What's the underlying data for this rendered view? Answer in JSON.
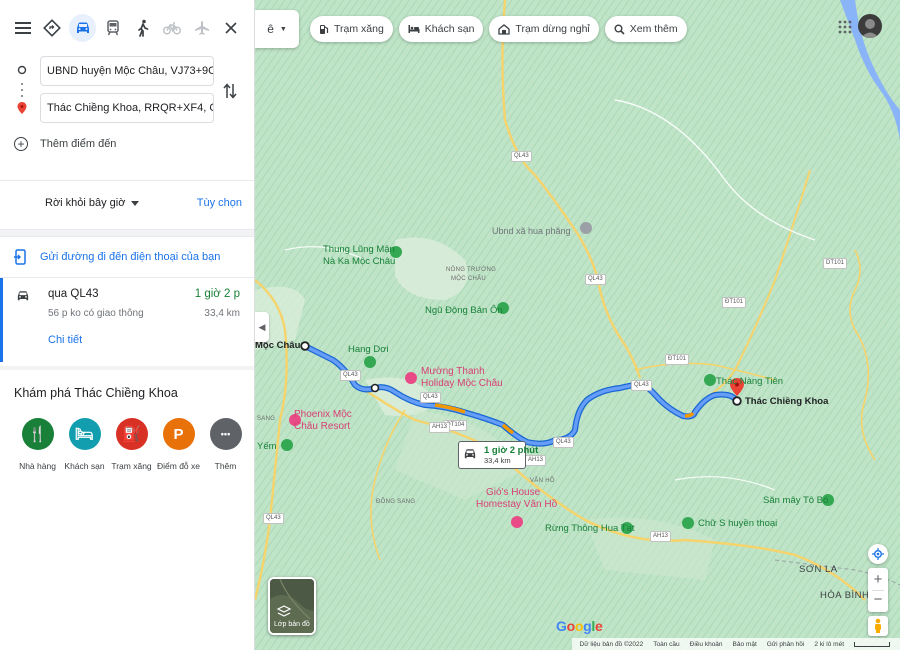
{
  "panel": {
    "travel_modes": [
      {
        "name": "best-route",
        "icon": "diamond-directions-icon",
        "state": "normal"
      },
      {
        "name": "driving",
        "icon": "car-icon",
        "state": "active"
      },
      {
        "name": "transit",
        "icon": "train-icon",
        "state": "normal"
      },
      {
        "name": "walking",
        "icon": "walk-icon",
        "state": "normal"
      },
      {
        "name": "cycling",
        "icon": "bicycle-icon",
        "state": "disabled"
      },
      {
        "name": "flights",
        "icon": "plane-icon",
        "state": "disabled"
      }
    ],
    "origin": "UBND huyện Mộc Châu, VJ73+9C3, TT. Mộc Châu",
    "destination": "Thác Chiềng Khoa, RRQR+XF4, Chiềng Khoa",
    "add_destination": "Thêm điểm đến",
    "depart_label": "Rời khỏi bây giờ",
    "options_label": "Tùy chọn",
    "send_to_phone": "Gửi đường đi đến điện thoại của bạn",
    "route": {
      "via": "qua QL43",
      "duration": "1 giờ 2 p",
      "traffic": "56 p ko có giao thông",
      "distance": "33,4 km",
      "details": "Chi tiết"
    },
    "explore": {
      "title": "Khám phá Thác Chiềng Khoa",
      "categories": [
        {
          "label": "Nhà hàng",
          "icon": "restaurant-icon",
          "color": "#188038",
          "glyph": "🍴"
        },
        {
          "label": "Khách sạn",
          "icon": "hotel-icon",
          "color": "#129eaf",
          "glyph": "🛏"
        },
        {
          "label": "Trạm xăng",
          "icon": "gas-station-icon",
          "color": "#d93025",
          "glyph": "⛽"
        },
        {
          "label": "Điểm đỗ xe",
          "icon": "parking-icon",
          "color": "#e8710a",
          "glyph": "P"
        },
        {
          "label": "Thêm",
          "icon": "more-icon",
          "color": "#5f6368",
          "glyph": "•••"
        }
      ]
    }
  },
  "map": {
    "collapse_text": "ê",
    "chips": [
      {
        "label": "Trạm xăng",
        "icon": "gas-station-icon"
      },
      {
        "label": "Khách sạn",
        "icon": "hotel-icon"
      },
      {
        "label": "Trạm dừng nghỉ",
        "icon": "rest-stop-icon"
      },
      {
        "label": "Xem thêm",
        "icon": "search-icon"
      }
    ],
    "labels": {
      "moc_chau": "Mộc Châu",
      "hang_doi": "Hang Dơi",
      "thung_lung": "Thung Lũng Mận",
      "na_ka": "Nà Ka Mộc Châu",
      "nong_truong_1": "NÔNG TRƯỜNG",
      "nong_truong_2": "MỘC CHÂU",
      "ngu_dong": "Ngũ Động Bản Ôn",
      "muong_thanh_1": "Mường Thanh",
      "muong_thanh_2": "Holiday Mộc Châu",
      "phoenix_1": "Phoenix Mộc",
      "phoenix_2": "Châu Resort",
      "ubnd_hua_phang": "Ubnd xã hua phăng",
      "thac_chieng_khoa": "Thác Chiềng Khoa",
      "thac_nang_tien": "Thác Nàng Tiên",
      "gio_house_1": "Gió's House",
      "gio_house_2": "Homestay Vân Hồ",
      "rung_thong": "Rừng Thông Hua Tạt",
      "chu_s": "Chữ S huyền thoại",
      "san_may": "Săn mây Tô Bó",
      "son_la": "SƠN LA",
      "hoa_binh": "HÒA BÌNH",
      "dong_sang": "ĐÔNG SANG",
      "van_ho": "VÂN HỒ",
      "sang": "SANG",
      "yem": "Yếm"
    },
    "road_shields": {
      "ql43": "QL43",
      "ql104": "QL104",
      "qt104": "QT104",
      "ah13": "AH13",
      "dt101": "DT101",
      "dt101b": "ĐT101",
      "ql43c": "ĐT101"
    },
    "callout": {
      "time": "1 giờ 2 phút",
      "distance": "33,4 km"
    },
    "layers_label": "Lớp bản đồ",
    "footer": {
      "data": "Dữ liệu bản đồ ©2022",
      "global": "Toàn cầu",
      "terms": "Điều khoản",
      "privacy": "Bảo mật",
      "feedback": "Gửi phản hồi",
      "scale": "2 ki lô mét"
    }
  }
}
